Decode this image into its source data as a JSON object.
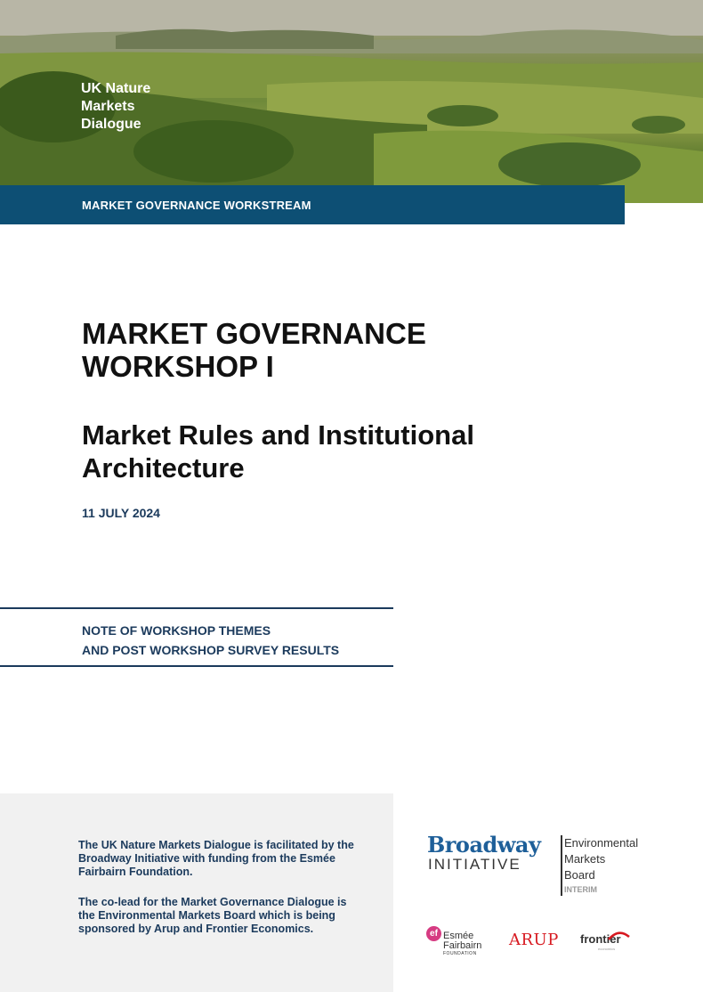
{
  "header": {
    "brand_lines": [
      "UK Nature",
      "Markets",
      "Dialogue"
    ],
    "band_label": "MARKET GOVERNANCE WORKSTREAM"
  },
  "main": {
    "title": "MARKET GOVERNANCE WORKSHOP I",
    "subtitle": "Market Rules and Institutional Architecture",
    "date": "11 JULY 2024"
  },
  "note": {
    "lines": [
      "NOTE OF WORKSHOP THEMES",
      "AND POST WORKSHOP SURVEY RESULTS"
    ]
  },
  "footer": {
    "paragraph1": "The UK Nature Markets Dialogue is facilitated by the Broadway Initiative with funding from the Esmée Fairbairn Foundation.",
    "paragraph2": "The co-lead for the Market Governance Dialogue is the Environmental Markets Board which is being sponsored by Arup and Frontier Economics."
  },
  "logos": {
    "broadway": {
      "line1": "Broadway",
      "line2": "INITIATIVE"
    },
    "emb": {
      "lines": [
        "Environmental",
        "Markets",
        "Board"
      ],
      "tag": "INTERIM"
    },
    "esmee": {
      "mark": "ef",
      "line1": "Esmée",
      "line2": "Fairbairn",
      "line3": "FOUNDATION"
    },
    "arup": "ARUP",
    "frontier": {
      "name": "frontier",
      "sub": "economics"
    }
  },
  "colors": {
    "band": "#0d4f74",
    "navy_text": "#1b3a5c",
    "broadway_blue": "#1e5f99",
    "arup_red": "#d71920",
    "esmee_pink": "#d63b82",
    "footer_panel": "#f1f1f1"
  }
}
